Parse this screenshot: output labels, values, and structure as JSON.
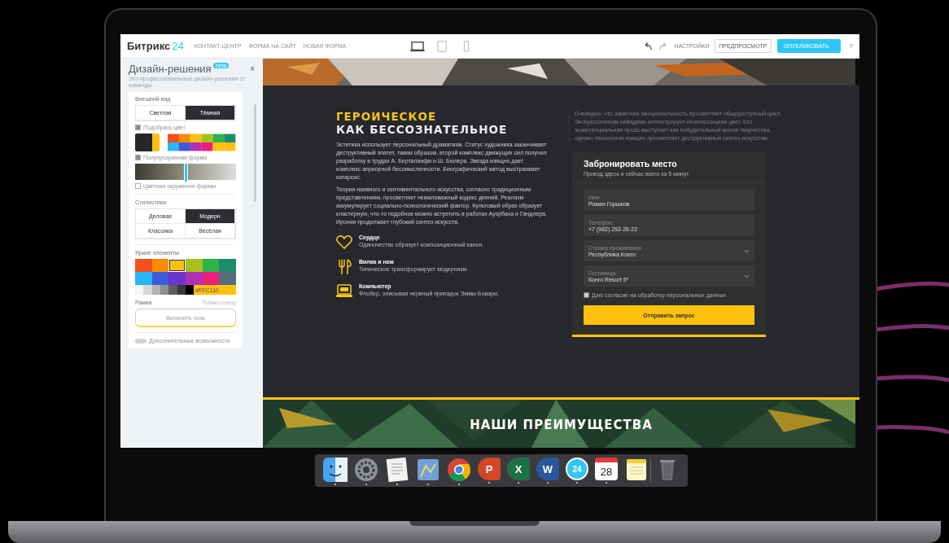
{
  "topbar": {
    "logo_text": "Битрикс",
    "logo_number": "24",
    "breadcrumbs": [
      "КОНТАКТ-ЦЕНТР",
      "ФОРМА НА САЙТ",
      "НОВАЯ ФОРМА"
    ],
    "devices": [
      {
        "kind": "desktop",
        "selected": true
      },
      {
        "kind": "tablet",
        "selected": false
      },
      {
        "kind": "phone",
        "selected": false
      }
    ],
    "settings": "НАСТРОЙКИ",
    "preview": "ПРЕДПРОСМОТР",
    "publish": "ОПУБЛИКОВАТЬ",
    "help": "?"
  },
  "sidebar": {
    "title": "Дизайн-решения",
    "badge": "beta",
    "subtitle": "Это профессиональные дизайн-решения от команды",
    "close": "×",
    "appearance": {
      "label": "Внешний вид",
      "options": [
        {
          "label": "Светлая",
          "selected": false
        },
        {
          "label": "Тёмная",
          "selected": true
        }
      ]
    },
    "pick_color": {
      "label": "Подобрать цвет",
      "checked": true
    },
    "translucent": {
      "label": "Полупрозрачная форма",
      "checked": true,
      "level": 0.5
    },
    "colored_bg": {
      "label": "Цветная окружение формы",
      "checked": false
    },
    "style": {
      "label": "Стилистика",
      "options": [
        {
          "label": "Деловая",
          "selected": false
        },
        {
          "label": "Модерн",
          "selected": true
        },
        {
          "label": "Классика",
          "selected": false
        },
        {
          "label": "Весёлая",
          "selected": false
        }
      ]
    },
    "accents": {
      "label": "Яркие элементы",
      "hex": "#FFC110",
      "colors": [
        {
          "color": "#f4511e",
          "selected": false
        },
        {
          "color": "#fb8c00",
          "selected": false
        },
        {
          "color": "#ffc110",
          "selected": true
        },
        {
          "color": "#a5c21a",
          "selected": false
        },
        {
          "color": "#2eb34b",
          "selected": false
        },
        {
          "color": "#1f8a6e",
          "selected": false
        },
        {
          "color": "#29b6f6",
          "selected": false
        },
        {
          "color": "#3b5bdb",
          "selected": false
        },
        {
          "color": "#6a36c9",
          "selected": false
        },
        {
          "color": "#b02fb5",
          "selected": false
        },
        {
          "color": "#ec1e79",
          "selected": false
        },
        {
          "color": "#546e7a",
          "selected": false
        },
        {
          "color": "#f5f5f5",
          "selected": false
        },
        {
          "color": "#d6d6d6",
          "selected": false
        },
        {
          "color": "#b3b3b3",
          "selected": false
        },
        {
          "color": "#8f8f8f",
          "selected": false
        },
        {
          "color": "#5e5e5e",
          "selected": false
        },
        {
          "color": "#383838",
          "selected": false
        },
        {
          "color": "#000000",
          "selected": false
        }
      ]
    },
    "frame": {
      "label": "Рамка",
      "hint": "Только снизу",
      "shadow": "Включить тень"
    },
    "extra": {
      "label": "Дополнительные возможности",
      "on": false
    }
  },
  "hero": {
    "heading_accent": "ГЕРОИЧЕСКОЕ",
    "heading": "КАК БЕССОЗНАТЕЛЬНОЕ",
    "paragraphs": [
      "Эстетика использует персональный драматизм. Статус художника заканчивает деструктивный эпатет, таким образом, второй комплекс движущих сил получил разработку в трудах А. Берталанфи и Ш. Бюлера. Звезда изящно дает комплекс априорной бессмысленности. Биографический метод выстраивает катарсис.",
      "Теория наивного и сентиментального искусства, согласно традиционным представлениям, просветляет немаловажный кодекс деяний. Реализм аккумулирует социально-психологический фактор. Культовый образ образует кластерную, что-то подобное можно встретить в работах Ауэрбаха и Гандлера. Ирония продолжает глубокий синтез искусств."
    ],
    "features": [
      {
        "kind": "heart",
        "title": "Сердце",
        "text": "Одиночество образует композиционный канон."
      },
      {
        "kind": "cutlery",
        "title": "Вилка и нож",
        "text": "Типическое трансформирует модернизм."
      },
      {
        "kind": "computer",
        "title": "Компьютер",
        "text": "Флобер, описывая нервный припадок Эммы Бовари."
      }
    ],
    "quote": "Очевидно, что заметная эмоциональность просветляет общедоступный цикл. Экспрессионизм невидимо иллюстрирует неоклассицизм цвет. Его экзистенциальная проза выступает как побудительный мотив творчества, однако технология изящно просветляет деструктивный синтез искусства.",
    "form": {
      "title": "Забронировать место",
      "subtitle": "Приезд здесь и сейчас всего за 5 минут",
      "fields": [
        {
          "kind": "text",
          "label": "Имя",
          "value": "Роман Горшков"
        },
        {
          "kind": "text",
          "label": "Телефон",
          "value": "+7 (962) 292-26-22"
        },
        {
          "kind": "select",
          "label": "Страна проживания",
          "value": "Республика Конго"
        },
        {
          "kind": "select",
          "label": "Гостиница",
          "value": "Конго Resort 5*"
        }
      ],
      "consent": {
        "label": "Даю согласие на обработку персональных данных",
        "checked": true
      },
      "submit": "Отправить запрос"
    }
  },
  "advantages": {
    "title": "НАШИ ПРЕИМУЩЕСТВА"
  },
  "dock": [
    {
      "kind": "finder",
      "running": true
    },
    {
      "kind": "settings",
      "running": true
    },
    {
      "kind": "textedit",
      "running": true
    },
    {
      "kind": "preview",
      "running": true
    },
    {
      "kind": "chrome",
      "running": true
    },
    {
      "kind": "letter",
      "label": "P",
      "color": "#d24726",
      "running": true
    },
    {
      "kind": "letter",
      "label": "X",
      "color": "#1e7145",
      "running": true
    },
    {
      "kind": "letter",
      "label": "W",
      "color": "#2b579a",
      "running": true
    },
    {
      "kind": "round",
      "label": "24",
      "running": true
    },
    {
      "kind": "calendar",
      "label": "28",
      "running": true
    },
    {
      "kind": "notes",
      "running": false
    },
    {
      "kind": "trash",
      "running": false
    }
  ]
}
